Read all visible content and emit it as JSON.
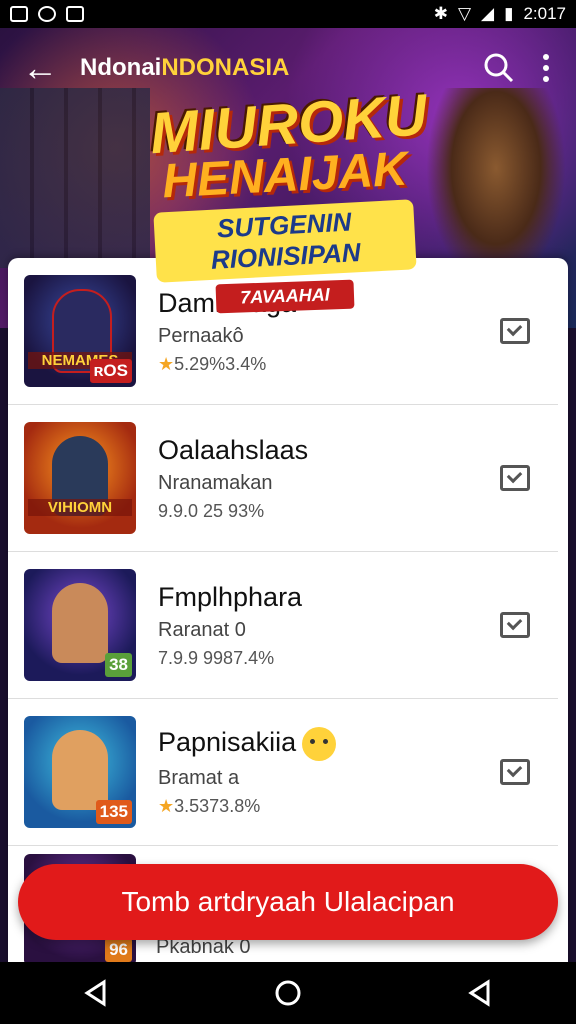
{
  "status_bar": {
    "time": "2:017"
  },
  "toolbar": {
    "title_part1": "Ndonai",
    "title_part2": "NDONASIA"
  },
  "banner": {
    "logo_line1": "MIUROKU",
    "logo_line2": "HENAIJAK",
    "logo_ribbon": "SUTGENIN RIONISIPAN",
    "logo_tag": "7AVAAHAI"
  },
  "games": [
    {
      "name": "Damitmaga",
      "developer": "Pernaakô",
      "rating": "5.29%3.4%",
      "has_star": true,
      "thumb_caption": "NEMAMES",
      "badge": "ʀOS",
      "emoji": false
    },
    {
      "name": "Oalaahslaas",
      "developer": "Nranamakan",
      "rating": "9.9.0 25 93%",
      "has_star": false,
      "thumb_caption": "VIHIOMN",
      "badge": "",
      "emoji": false
    },
    {
      "name": "Fmplhphara",
      "developer": "Raranat 0",
      "rating": "7.9.9 9987.4%",
      "has_star": false,
      "thumb_caption": "",
      "badge": "38",
      "emoji": false
    },
    {
      "name": "Papnisakiia",
      "developer": "Bramat a",
      "rating": "3.5373.8%",
      "has_star": true,
      "thumb_caption": "",
      "badge": "135",
      "emoji": true
    }
  ],
  "peek_item": {
    "developer": "Pkabnak 0",
    "badge": "96"
  },
  "cta": {
    "label": "Tomb artdryaah Ulalacipan"
  },
  "colors": {
    "accent": "#e11a1a",
    "star": "#f5a623",
    "title_accent": "#ffd23a"
  }
}
